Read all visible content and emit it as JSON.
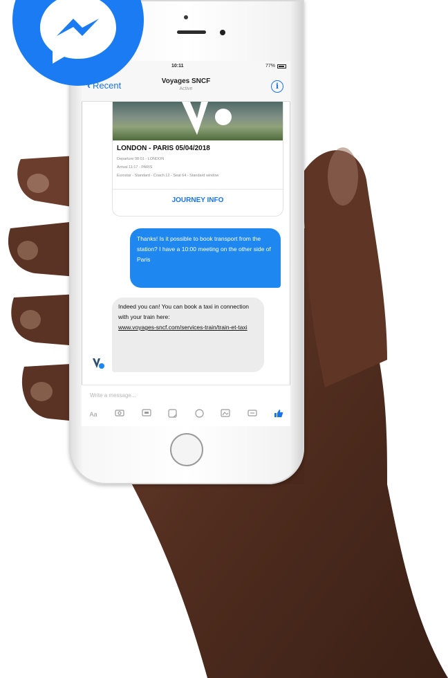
{
  "badge": {
    "icon": "messenger-logo-icon",
    "color": "#1a7bf2"
  },
  "status_bar": {
    "time": "10:11",
    "battery": "77%"
  },
  "nav": {
    "back_label": "Recent",
    "title": "Voyages SNCF",
    "subtitle": "Active",
    "info_icon": "info-icon"
  },
  "card": {
    "title": "LONDON - PARIS 05/04/2018",
    "lines": [
      "Departure 08:01 - LONDON",
      "Arrival 11:17 - PARIS",
      "Eurostar - Standard - Coach 12 - Seat 64 - Standard window"
    ],
    "button_label": "JOURNEY INFO"
  },
  "messages": {
    "outgoing": "Thanks! Is it possible to book transport from the station? I have a 10:00 meeting on the other side of Paris",
    "incoming_text": "Indeed you can! You can book a taxi in connection with your train here:",
    "incoming_link": "www.voyages-sncf.com/services-train/train-et-taxi"
  },
  "composer": {
    "placeholder": "Write a message...",
    "tools": [
      "Aa",
      "camera-icon",
      "gif-icon",
      "sticker-icon",
      "emoji-icon",
      "image-icon",
      "like-icon"
    ]
  },
  "colors": {
    "accent": "#1a73e8",
    "bubble_out": "#1e88f0",
    "bubble_in": "#ececec",
    "skin": "#5a3222"
  }
}
